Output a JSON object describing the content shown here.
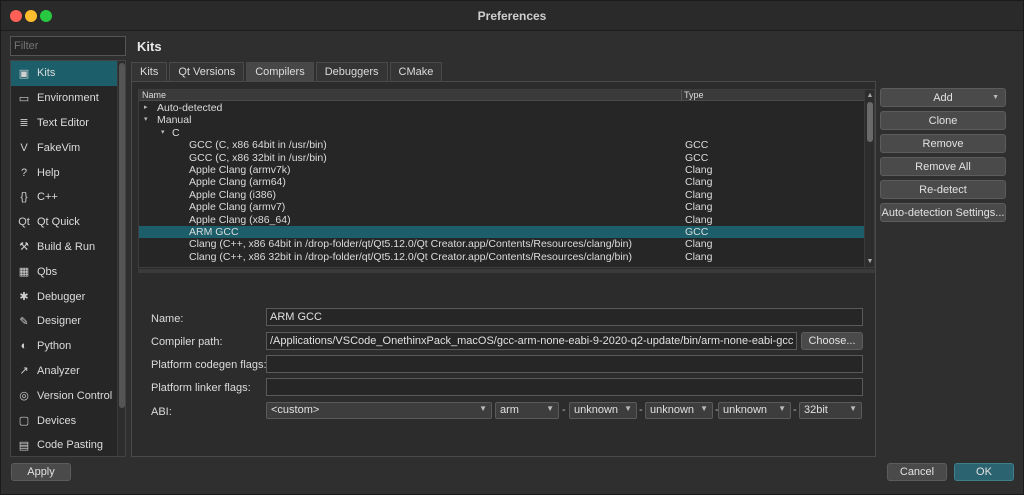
{
  "window": {
    "title": "Preferences"
  },
  "filter": {
    "placeholder": "Filter"
  },
  "sidebar": {
    "items": [
      {
        "label": "Kits",
        "icon": "kits-icon",
        "glyph": "▣",
        "active": true
      },
      {
        "label": "Environment",
        "icon": "monitor-icon",
        "glyph": "▭"
      },
      {
        "label": "Text Editor",
        "icon": "text-editor-icon",
        "glyph": "≣"
      },
      {
        "label": "FakeVim",
        "icon": "fakevim-icon",
        "glyph": "V"
      },
      {
        "label": "Help",
        "icon": "help-icon",
        "glyph": "?"
      },
      {
        "label": "C++",
        "icon": "cpp-icon",
        "glyph": "{}"
      },
      {
        "label": "Qt Quick",
        "icon": "qt-quick-icon",
        "glyph": "Qt"
      },
      {
        "label": "Build & Run",
        "icon": "hammer-icon",
        "glyph": "⚒"
      },
      {
        "label": "Qbs",
        "icon": "qbs-icon",
        "glyph": "▦"
      },
      {
        "label": "Debugger",
        "icon": "bug-icon",
        "glyph": "✱"
      },
      {
        "label": "Designer",
        "icon": "pencil-icon",
        "glyph": "✎"
      },
      {
        "label": "Python",
        "icon": "python-icon",
        "glyph": "◐"
      },
      {
        "label": "Analyzer",
        "icon": "analyzer-icon",
        "glyph": "↗"
      },
      {
        "label": "Version Control",
        "icon": "version-control-icon",
        "glyph": "◎"
      },
      {
        "label": "Devices",
        "icon": "devices-icon",
        "glyph": "▢"
      },
      {
        "label": "Code Pasting",
        "icon": "clipboard-icon",
        "glyph": "▤"
      }
    ]
  },
  "page": {
    "heading": "Kits"
  },
  "tabs": [
    {
      "label": "Kits"
    },
    {
      "label": "Qt Versions"
    },
    {
      "label": "Compilers",
      "active": true
    },
    {
      "label": "Debuggers"
    },
    {
      "label": "CMake"
    }
  ],
  "tree": {
    "headers": {
      "name": "Name",
      "type": "Type"
    },
    "rows": [
      {
        "name": "Auto-detected",
        "type": "",
        "level": 0,
        "arrow": "▸"
      },
      {
        "name": "Manual",
        "type": "",
        "level": 0,
        "arrow": "▾"
      },
      {
        "name": "C",
        "type": "",
        "level": 1,
        "arrow": "▾"
      },
      {
        "name": "GCC (C, x86 64bit in /usr/bin)",
        "type": "GCC",
        "level": 2
      },
      {
        "name": "GCC (C, x86 32bit in /usr/bin)",
        "type": "GCC",
        "level": 2
      },
      {
        "name": "Apple Clang (armv7k)",
        "type": "Clang",
        "level": 2
      },
      {
        "name": "Apple Clang (arm64)",
        "type": "Clang",
        "level": 2
      },
      {
        "name": "Apple Clang (i386)",
        "type": "Clang",
        "level": 2
      },
      {
        "name": "Apple Clang (armv7)",
        "type": "Clang",
        "level": 2
      },
      {
        "name": "Apple Clang (x86_64)",
        "type": "Clang",
        "level": 2
      },
      {
        "name": "ARM GCC",
        "type": "GCC",
        "level": 2,
        "selected": true
      },
      {
        "name": "Clang (C++, x86 64bit in /drop-folder/qt/Qt5.12.0/Qt Creator.app/Contents/Resources/clang/bin)",
        "type": "Clang",
        "level": 2
      },
      {
        "name": "Clang (C++, x86 32bit in /drop-folder/qt/Qt5.12.0/Qt Creator.app/Contents/Resources/clang/bin)",
        "type": "Clang",
        "level": 2
      }
    ]
  },
  "actions": {
    "add": "Add",
    "clone": "Clone",
    "remove": "Remove",
    "remove_all": "Remove All",
    "redetect": "Re-detect",
    "auto_detection_settings": "Auto-detection Settings..."
  },
  "form": {
    "name_label": "Name:",
    "name_value": "ARM GCC",
    "compiler_path_label": "Compiler path:",
    "compiler_path_value": "/Applications/VSCode_OnethinxPack_macOS/gcc-arm-none-eabi-9-2020-q2-update/bin/arm-none-eabi-gcc",
    "choose_button": "Choose...",
    "codegen_label": "Platform codegen flags:",
    "codegen_value": "",
    "linker_label": "Platform linker flags:",
    "linker_value": "",
    "abi_label": "ABI:",
    "abi_preset": "<custom>",
    "abi_arch": "arm",
    "abi_os": "unknown",
    "abi_flavor": "unknown",
    "abi_format": "unknown",
    "abi_width": "32bit",
    "separator": "-"
  },
  "footer": {
    "apply": "Apply",
    "cancel": "Cancel",
    "ok": "OK"
  },
  "colors": {
    "selection": "#1c5f6b",
    "background": "#2f2f2f"
  }
}
